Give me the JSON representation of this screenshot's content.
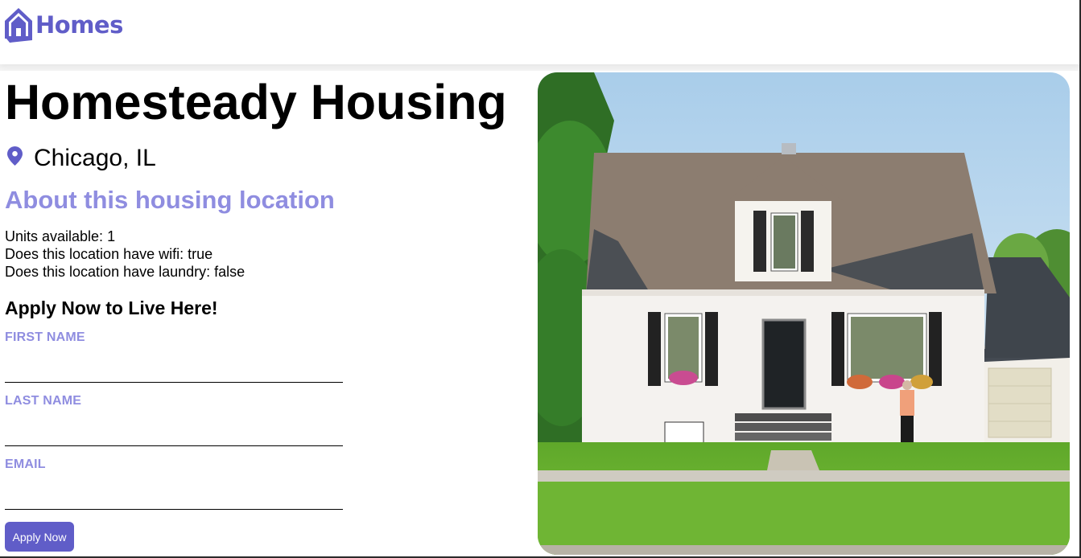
{
  "header": {
    "brand_text": "Homes",
    "brand_icon": "house-icon",
    "brand_color": "#605DC8"
  },
  "listing": {
    "name": "Homesteady Housing",
    "location_icon": "location-pin-icon",
    "location": "Chicago, IL",
    "about_heading": "About this housing location",
    "facts": {
      "units": "Units available: 1",
      "wifi": "Does this location have wifi: true",
      "laundry": "Does this location have laundry: false"
    },
    "photo_alt": ""
  },
  "form": {
    "heading": "Apply Now to Live Here!",
    "first_name_label": "FIRST NAME",
    "first_name_value": "",
    "last_name_label": "LAST NAME",
    "last_name_value": "",
    "email_label": "EMAIL",
    "email_value": "",
    "submit_label": "Apply Now"
  },
  "colors": {
    "accent": "#605DC8",
    "accent_light": "#8f8de0"
  }
}
